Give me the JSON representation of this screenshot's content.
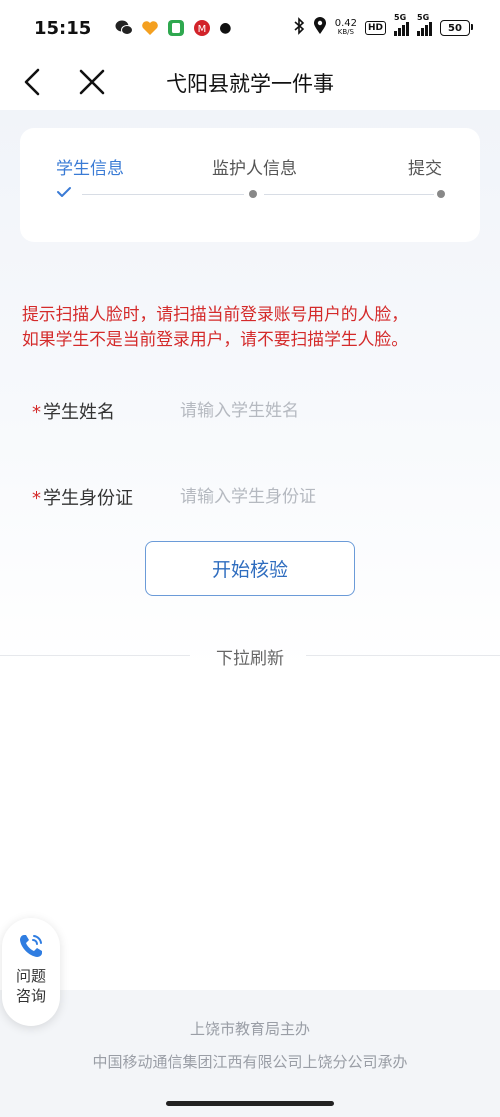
{
  "status_bar": {
    "time": "15:15",
    "net_speed": "0.42",
    "net_unit": "KB/S",
    "hd": "HD",
    "sig1_gen": "5G",
    "sig2_gen": "5G",
    "battery": "50",
    "icons": [
      "wechat-icon",
      "heart-app-icon",
      "phone-app-icon",
      "bank-app-icon",
      "dot-icon",
      "bluetooth-icon",
      "location-icon"
    ]
  },
  "nav": {
    "title": "弋阳县就学一件事"
  },
  "steps": [
    {
      "label": "学生信息",
      "state": "done"
    },
    {
      "label": "监护人信息",
      "state": "pending"
    },
    {
      "label": "提交",
      "state": "pending"
    }
  ],
  "colors": {
    "accent": "#3a7bd5",
    "warning": "#d42a2a",
    "button_text": "#2f6dbf"
  },
  "tip": {
    "line1": "提示扫描人脸时，请扫描当前登录账号用户的人脸，",
    "line2": "如果学生不是当前登录用户，请不要扫描学生人脸。"
  },
  "form": {
    "name_required": "*",
    "name_label": "学生姓名",
    "name_placeholder": "请输入学生姓名",
    "id_required": "*",
    "id_label": "学生身份证",
    "id_placeholder": "请输入学生身份证"
  },
  "verify_button": "开始核验",
  "pull_refresh": "下拉刷新",
  "help": {
    "label": "问题咨询"
  },
  "footer": {
    "line1": "上饶市教育局主办",
    "line2": "中国移动通信集团江西有限公司上饶分公司承办"
  }
}
